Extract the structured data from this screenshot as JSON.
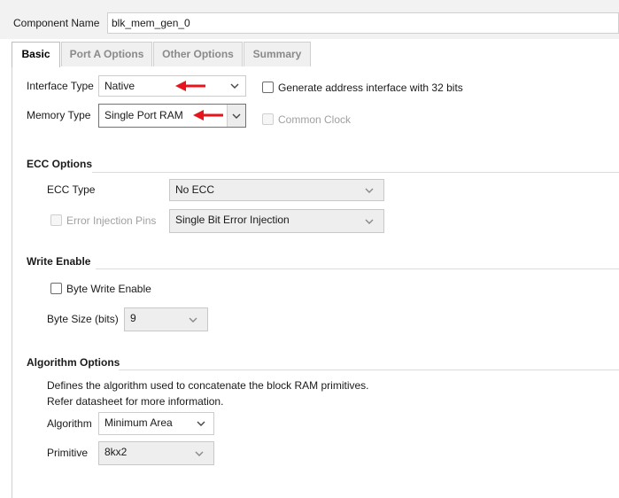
{
  "component": {
    "label": "Component Name",
    "value": "blk_mem_gen_0"
  },
  "tabs": [
    {
      "label": "Basic",
      "active": true
    },
    {
      "label": "Port A Options"
    },
    {
      "label": "Other Options"
    },
    {
      "label": "Summary"
    }
  ],
  "basic": {
    "interface_type": {
      "label": "Interface Type",
      "value": "Native"
    },
    "generate_address": {
      "label": "Generate address interface with 32 bits",
      "checked": false
    },
    "memory_type": {
      "label": "Memory Type",
      "value": "Single Port RAM"
    },
    "common_clock": {
      "label": "Common Clock",
      "checked": false,
      "disabled": true
    }
  },
  "ecc": {
    "title": "ECC Options",
    "ecc_type": {
      "label": "ECC Type",
      "value": "No ECC"
    },
    "error_injection": {
      "label": "Error Injection Pins",
      "value": "Single Bit Error Injection",
      "checked": false
    }
  },
  "write_enable": {
    "title": "Write Enable",
    "byte_write_enable": {
      "label": "Byte Write Enable",
      "checked": false
    },
    "byte_size": {
      "label": "Byte Size (bits)",
      "value": "9"
    }
  },
  "algorithm": {
    "title": "Algorithm Options",
    "description_line1": "Defines the algorithm used to concatenate the block RAM primitives.",
    "description_line2": "Refer datasheet for more information.",
    "algorithm": {
      "label": "Algorithm",
      "value": "Minimum Area"
    },
    "primitive": {
      "label": "Primitive",
      "value": "8kx2"
    }
  },
  "colors": {
    "annotation_arrow": "#e8141b",
    "focus_border": "#3d7cc9"
  }
}
